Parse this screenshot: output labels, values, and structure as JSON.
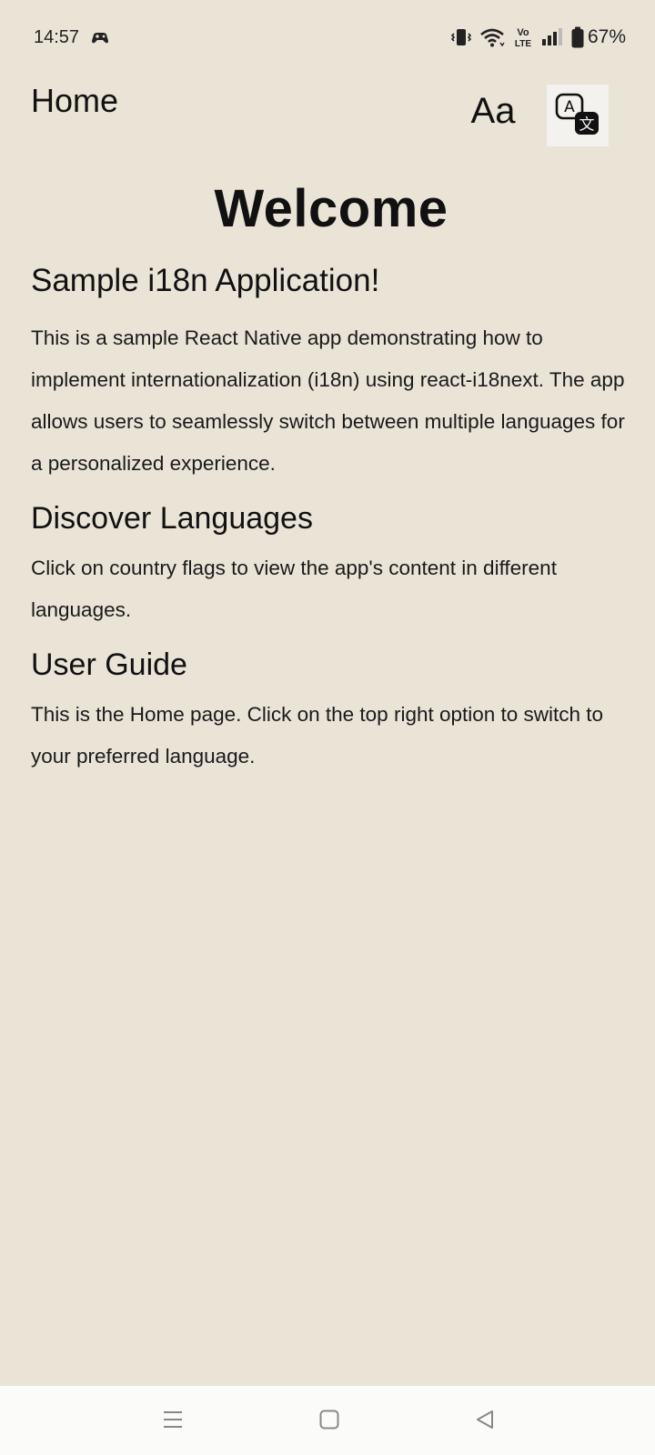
{
  "status_bar": {
    "time": "14:57",
    "app_icon": "gamepad-icon",
    "icons": [
      "vibrate-icon",
      "wifi-icon",
      "volte-icon",
      "signal-icon",
      "battery-icon"
    ],
    "battery": "67%",
    "battery_level": 0.67,
    "volte_top": "Vo",
    "volte_bottom": "LTE"
  },
  "header": {
    "title": "Home",
    "font_size_label": "Aa",
    "language_icon": "translate-icon",
    "language_icon_glyph_a": "A",
    "language_icon_glyph_wen": "文"
  },
  "main": {
    "welcome": "Welcome",
    "subtitle": "Sample i18n Application!",
    "intro": "This is a sample React Native app demonstrating how to implement internationalization (i18n) using react-i18next. The app allows users to seamlessly switch between multiple languages for a personalized experience.",
    "discover_heading": "Discover Languages",
    "discover_text": "Click on country flags to view the app's content in different languages.",
    "guide_heading": "User Guide",
    "guide_text": "This is the Home page. Click on the top right option to switch to your preferred language."
  },
  "nav_bar": {
    "icons": [
      "menu-icon",
      "home-icon",
      "back-icon"
    ]
  },
  "colors": {
    "background": "#e9e4d6",
    "nav_background": "#fbfbfa",
    "text": "#111111"
  }
}
